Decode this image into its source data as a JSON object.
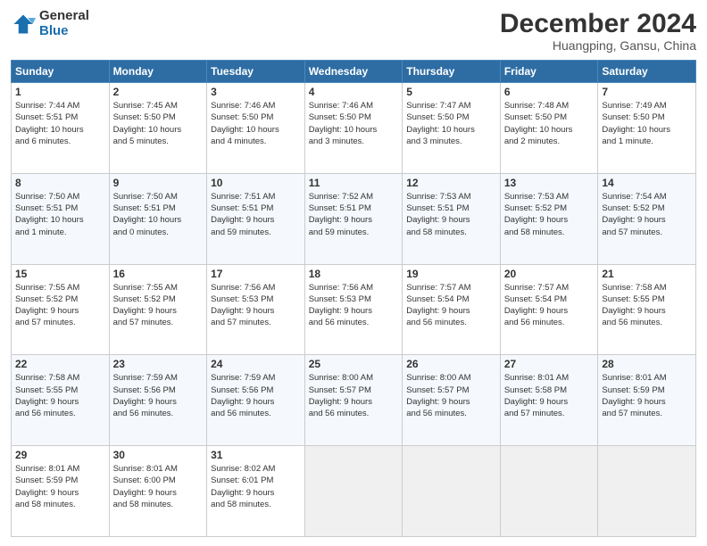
{
  "logo": {
    "general": "General",
    "blue": "Blue"
  },
  "header": {
    "month": "December 2024",
    "location": "Huangping, Gansu, China"
  },
  "weekdays": [
    "Sunday",
    "Monday",
    "Tuesday",
    "Wednesday",
    "Thursday",
    "Friday",
    "Saturday"
  ],
  "weeks": [
    [
      {
        "day": "1",
        "lines": [
          "Sunrise: 7:44 AM",
          "Sunset: 5:51 PM",
          "Daylight: 10 hours",
          "and 6 minutes."
        ]
      },
      {
        "day": "2",
        "lines": [
          "Sunrise: 7:45 AM",
          "Sunset: 5:50 PM",
          "Daylight: 10 hours",
          "and 5 minutes."
        ]
      },
      {
        "day": "3",
        "lines": [
          "Sunrise: 7:46 AM",
          "Sunset: 5:50 PM",
          "Daylight: 10 hours",
          "and 4 minutes."
        ]
      },
      {
        "day": "4",
        "lines": [
          "Sunrise: 7:46 AM",
          "Sunset: 5:50 PM",
          "Daylight: 10 hours",
          "and 3 minutes."
        ]
      },
      {
        "day": "5",
        "lines": [
          "Sunrise: 7:47 AM",
          "Sunset: 5:50 PM",
          "Daylight: 10 hours",
          "and 3 minutes."
        ]
      },
      {
        "day": "6",
        "lines": [
          "Sunrise: 7:48 AM",
          "Sunset: 5:50 PM",
          "Daylight: 10 hours",
          "and 2 minutes."
        ]
      },
      {
        "day": "7",
        "lines": [
          "Sunrise: 7:49 AM",
          "Sunset: 5:50 PM",
          "Daylight: 10 hours",
          "and 1 minute."
        ]
      }
    ],
    [
      {
        "day": "8",
        "lines": [
          "Sunrise: 7:50 AM",
          "Sunset: 5:51 PM",
          "Daylight: 10 hours",
          "and 1 minute."
        ]
      },
      {
        "day": "9",
        "lines": [
          "Sunrise: 7:50 AM",
          "Sunset: 5:51 PM",
          "Daylight: 10 hours",
          "and 0 minutes."
        ]
      },
      {
        "day": "10",
        "lines": [
          "Sunrise: 7:51 AM",
          "Sunset: 5:51 PM",
          "Daylight: 9 hours",
          "and 59 minutes."
        ]
      },
      {
        "day": "11",
        "lines": [
          "Sunrise: 7:52 AM",
          "Sunset: 5:51 PM",
          "Daylight: 9 hours",
          "and 59 minutes."
        ]
      },
      {
        "day": "12",
        "lines": [
          "Sunrise: 7:53 AM",
          "Sunset: 5:51 PM",
          "Daylight: 9 hours",
          "and 58 minutes."
        ]
      },
      {
        "day": "13",
        "lines": [
          "Sunrise: 7:53 AM",
          "Sunset: 5:52 PM",
          "Daylight: 9 hours",
          "and 58 minutes."
        ]
      },
      {
        "day": "14",
        "lines": [
          "Sunrise: 7:54 AM",
          "Sunset: 5:52 PM",
          "Daylight: 9 hours",
          "and 57 minutes."
        ]
      }
    ],
    [
      {
        "day": "15",
        "lines": [
          "Sunrise: 7:55 AM",
          "Sunset: 5:52 PM",
          "Daylight: 9 hours",
          "and 57 minutes."
        ]
      },
      {
        "day": "16",
        "lines": [
          "Sunrise: 7:55 AM",
          "Sunset: 5:52 PM",
          "Daylight: 9 hours",
          "and 57 minutes."
        ]
      },
      {
        "day": "17",
        "lines": [
          "Sunrise: 7:56 AM",
          "Sunset: 5:53 PM",
          "Daylight: 9 hours",
          "and 57 minutes."
        ]
      },
      {
        "day": "18",
        "lines": [
          "Sunrise: 7:56 AM",
          "Sunset: 5:53 PM",
          "Daylight: 9 hours",
          "and 56 minutes."
        ]
      },
      {
        "day": "19",
        "lines": [
          "Sunrise: 7:57 AM",
          "Sunset: 5:54 PM",
          "Daylight: 9 hours",
          "and 56 minutes."
        ]
      },
      {
        "day": "20",
        "lines": [
          "Sunrise: 7:57 AM",
          "Sunset: 5:54 PM",
          "Daylight: 9 hours",
          "and 56 minutes."
        ]
      },
      {
        "day": "21",
        "lines": [
          "Sunrise: 7:58 AM",
          "Sunset: 5:55 PM",
          "Daylight: 9 hours",
          "and 56 minutes."
        ]
      }
    ],
    [
      {
        "day": "22",
        "lines": [
          "Sunrise: 7:58 AM",
          "Sunset: 5:55 PM",
          "Daylight: 9 hours",
          "and 56 minutes."
        ]
      },
      {
        "day": "23",
        "lines": [
          "Sunrise: 7:59 AM",
          "Sunset: 5:56 PM",
          "Daylight: 9 hours",
          "and 56 minutes."
        ]
      },
      {
        "day": "24",
        "lines": [
          "Sunrise: 7:59 AM",
          "Sunset: 5:56 PM",
          "Daylight: 9 hours",
          "and 56 minutes."
        ]
      },
      {
        "day": "25",
        "lines": [
          "Sunrise: 8:00 AM",
          "Sunset: 5:57 PM",
          "Daylight: 9 hours",
          "and 56 minutes."
        ]
      },
      {
        "day": "26",
        "lines": [
          "Sunrise: 8:00 AM",
          "Sunset: 5:57 PM",
          "Daylight: 9 hours",
          "and 56 minutes."
        ]
      },
      {
        "day": "27",
        "lines": [
          "Sunrise: 8:01 AM",
          "Sunset: 5:58 PM",
          "Daylight: 9 hours",
          "and 57 minutes."
        ]
      },
      {
        "day": "28",
        "lines": [
          "Sunrise: 8:01 AM",
          "Sunset: 5:59 PM",
          "Daylight: 9 hours",
          "and 57 minutes."
        ]
      }
    ],
    [
      {
        "day": "29",
        "lines": [
          "Sunrise: 8:01 AM",
          "Sunset: 5:59 PM",
          "Daylight: 9 hours",
          "and 58 minutes."
        ]
      },
      {
        "day": "30",
        "lines": [
          "Sunrise: 8:01 AM",
          "Sunset: 6:00 PM",
          "Daylight: 9 hours",
          "and 58 minutes."
        ]
      },
      {
        "day": "31",
        "lines": [
          "Sunrise: 8:02 AM",
          "Sunset: 6:01 PM",
          "Daylight: 9 hours",
          "and 58 minutes."
        ]
      },
      {
        "day": "",
        "lines": []
      },
      {
        "day": "",
        "lines": []
      },
      {
        "day": "",
        "lines": []
      },
      {
        "day": "",
        "lines": []
      }
    ]
  ]
}
